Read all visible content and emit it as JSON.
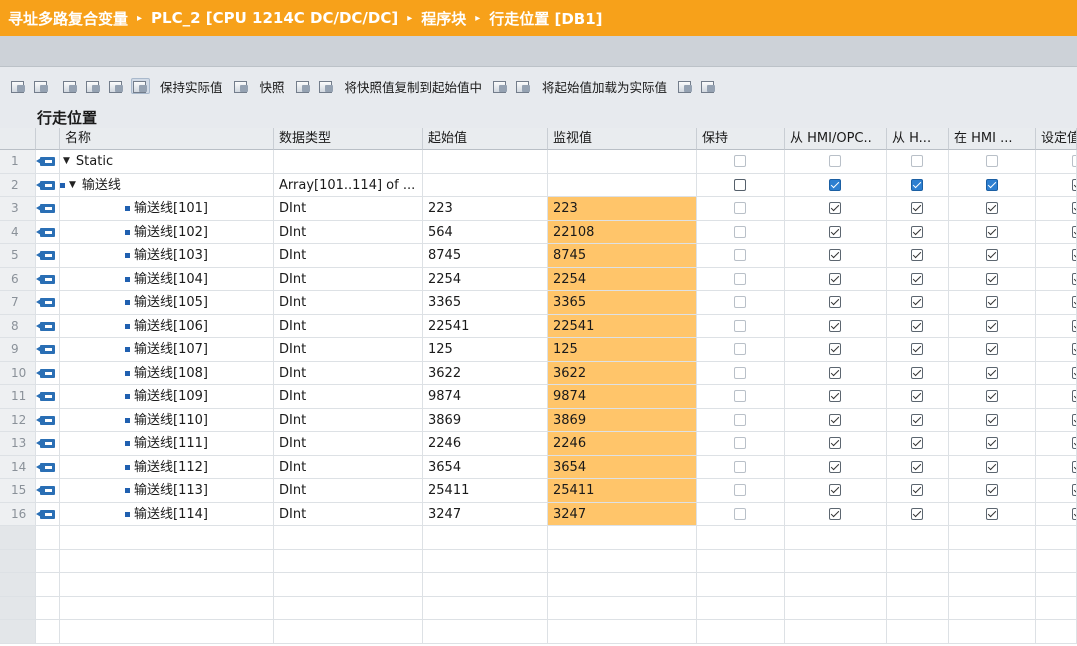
{
  "breadcrumb": [
    "寻址多路复合变量",
    "PLC_2 [CPU 1214C DC/DC/DC]",
    "程序块",
    "行走位置 [DB1]"
  ],
  "breadcrumb_separator": "▸",
  "toolbar": {
    "keep_actual": "保持实际值",
    "snapshot": "快照",
    "copy_snapshot": "将快照值复制到起始值中",
    "load_start": "将起始值加载为实际值"
  },
  "db_title": "行走位置",
  "columns": {
    "name": "名称",
    "type": "数据类型",
    "start": "起始值",
    "monitor": "监视值",
    "retain": "保持",
    "hmi_access": "从 HMI/OPC..",
    "hmi_write": "从 H...",
    "hmi_visible": "在 HMI ...",
    "setpoint": "设定值"
  },
  "rows": [
    {
      "num": "1",
      "name": "Static",
      "level": 0,
      "expand": "▼",
      "type": "",
      "start": "",
      "monitor": "",
      "retain": "unchecked",
      "h1": "unchecked",
      "h2": "unchecked",
      "h3": "unchecked",
      "set": "unchecked"
    },
    {
      "num": "2",
      "name": "输送线",
      "level": 1,
      "expand": "▼",
      "type": "Array[101..114] of ...",
      "start": "",
      "monitor": "",
      "retain": "dark",
      "h1": "blue",
      "h2": "blue",
      "h3": "blue",
      "set": "checked"
    },
    {
      "num": "3",
      "name": "输送线[101]",
      "level": 2,
      "type": "DInt",
      "start": "223",
      "monitor": "223"
    },
    {
      "num": "4",
      "name": "输送线[102]",
      "level": 2,
      "type": "DInt",
      "start": "564",
      "monitor": "22108"
    },
    {
      "num": "5",
      "name": "输送线[103]",
      "level": 2,
      "type": "DInt",
      "start": "8745",
      "monitor": "8745"
    },
    {
      "num": "6",
      "name": "输送线[104]",
      "level": 2,
      "type": "DInt",
      "start": "2254",
      "monitor": "2254"
    },
    {
      "num": "7",
      "name": "输送线[105]",
      "level": 2,
      "type": "DInt",
      "start": "3365",
      "monitor": "3365"
    },
    {
      "num": "8",
      "name": "输送线[106]",
      "level": 2,
      "type": "DInt",
      "start": "22541",
      "monitor": "22541"
    },
    {
      "num": "9",
      "name": "输送线[107]",
      "level": 2,
      "type": "DInt",
      "start": "125",
      "monitor": "125"
    },
    {
      "num": "10",
      "name": "输送线[108]",
      "level": 2,
      "type": "DInt",
      "start": "3622",
      "monitor": "3622"
    },
    {
      "num": "11",
      "name": "输送线[109]",
      "level": 2,
      "type": "DInt",
      "start": "9874",
      "monitor": "9874"
    },
    {
      "num": "12",
      "name": "输送线[110]",
      "level": 2,
      "type": "DInt",
      "start": "3869",
      "monitor": "3869"
    },
    {
      "num": "13",
      "name": "输送线[111]",
      "level": 2,
      "type": "DInt",
      "start": "2246",
      "monitor": "2246"
    },
    {
      "num": "14",
      "name": "输送线[112]",
      "level": 2,
      "type": "DInt",
      "start": "3654",
      "monitor": "3654"
    },
    {
      "num": "15",
      "name": "输送线[113]",
      "level": 2,
      "type": "DInt",
      "start": "25411",
      "monitor": "25411"
    },
    {
      "num": "16",
      "name": "输送线[114]",
      "level": 2,
      "type": "DInt",
      "start": "3247",
      "monitor": "3247"
    }
  ],
  "colors": {
    "titlebar": "#f7a11a",
    "monitor_cell": "#ffc56a",
    "db_icon": "#2a6fb5"
  }
}
